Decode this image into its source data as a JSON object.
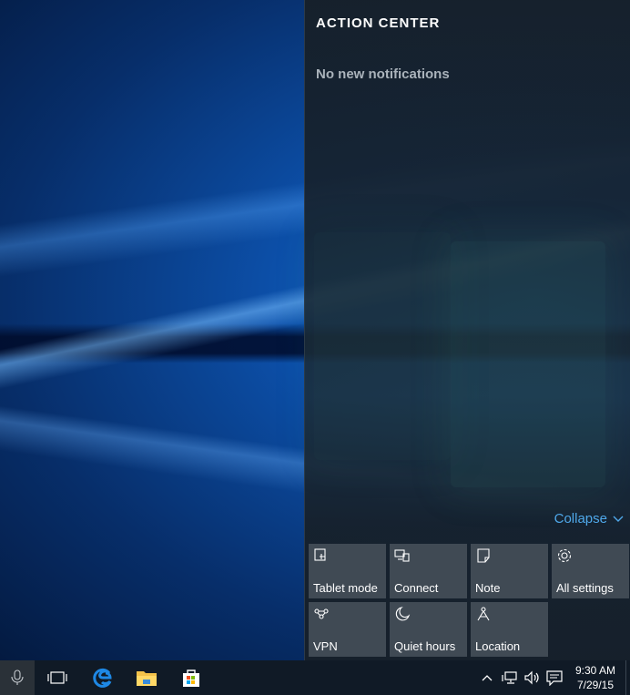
{
  "action_center": {
    "title": "ACTION CENTER",
    "empty_message": "No new notifications",
    "collapse_label": "Collapse",
    "quick_actions": [
      {
        "label": "Tablet mode",
        "icon": "tablet-mode-icon"
      },
      {
        "label": "Connect",
        "icon": "connect-icon"
      },
      {
        "label": "Note",
        "icon": "note-icon"
      },
      {
        "label": "All settings",
        "icon": "gear-icon"
      },
      {
        "label": "VPN",
        "icon": "vpn-icon"
      },
      {
        "label": "Quiet hours",
        "icon": "moon-icon"
      },
      {
        "label": "Location",
        "icon": "location-icon"
      }
    ]
  },
  "taskbar": {
    "pinned": [
      "microphone-icon",
      "task-view-icon",
      "edge-icon",
      "file-explorer-icon",
      "store-icon"
    ],
    "tray": [
      "chevron-up-icon",
      "network-icon",
      "volume-icon",
      "action-center-icon"
    ],
    "clock": {
      "time": "9:30 AM",
      "date": "7/29/15"
    }
  },
  "colors": {
    "accent": "#4fa8ea",
    "tile": "#404a54",
    "panel": "#16202a",
    "taskbar": "#101a26"
  }
}
